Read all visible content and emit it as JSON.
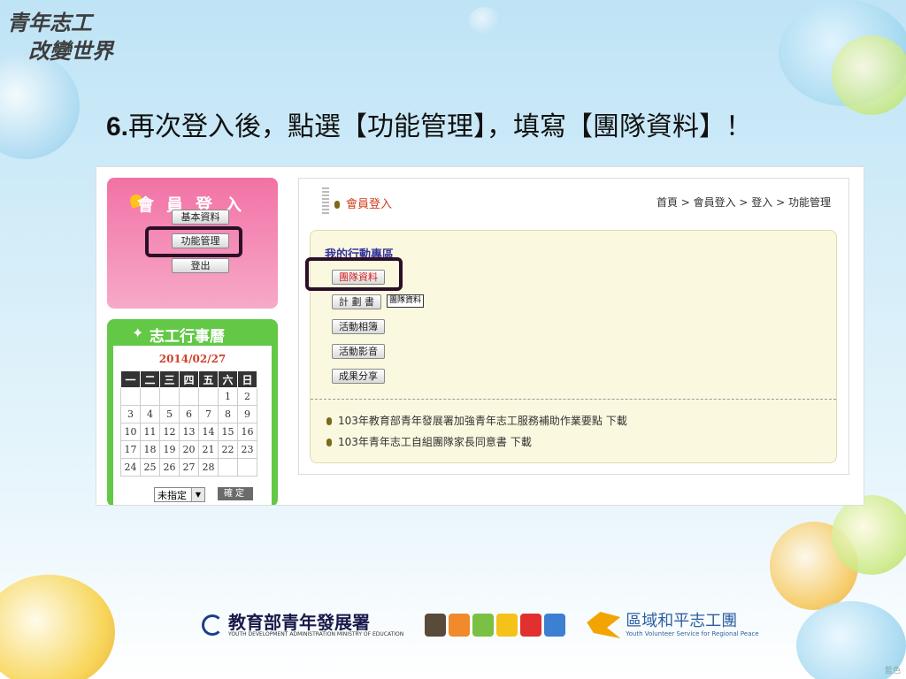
{
  "slogan": {
    "line1": "青年志工",
    "line2": "改變世界"
  },
  "heading": {
    "step": "6.",
    "text": "再次登入後，點選【功能管理】，填寫【團隊資料】！"
  },
  "login": {
    "title": "會員登入",
    "buttons": {
      "basic": "基本資料",
      "manage": "功能管理",
      "logout": "登出"
    }
  },
  "calendar": {
    "title": "志工行事曆",
    "date": "2014/02/27",
    "weekdays": [
      "一",
      "二",
      "三",
      "四",
      "五",
      "六",
      "日"
    ],
    "weeks": [
      [
        "",
        "",
        "",
        "",
        "",
        "1",
        "2"
      ],
      [
        "3",
        "4",
        "5",
        "6",
        "7",
        "8",
        "9"
      ],
      [
        "10",
        "11",
        "12",
        "13",
        "14",
        "15",
        "16"
      ],
      [
        "17",
        "18",
        "19",
        "20",
        "21",
        "22",
        "23"
      ],
      [
        "24",
        "25",
        "26",
        "27",
        "28",
        "",
        ""
      ]
    ],
    "select_value": "未指定",
    "confirm": "確定"
  },
  "main": {
    "title": "會員登入",
    "breadcrumb": "首頁 > 會員登入 > 登入 > 功能管理",
    "section_title": "我的行動專區",
    "buttons": {
      "team": "團隊資料",
      "plan": "計 劃 書",
      "album": "活動相簿",
      "video": "活動影音",
      "share": "成果分享"
    },
    "tooltip": "團隊資料",
    "downloads": [
      {
        "text": "103年教育部青年發展署加強青年志工服務補助作業要點",
        "link": "下載"
      },
      {
        "text": "103年青年志工自組團隊家長同意書",
        "link": "下載"
      }
    ]
  },
  "footer": {
    "logo1": "教育部青年發展署",
    "logo1_sub": "YOUTH DEVELOPMENT ADMINISTRATION MINISTRY OF EDUCATION",
    "logo3": "區域和平志工團",
    "logo3_sub": "Youth Volunteer Service for Regional Peace",
    "corner": "藍色"
  },
  "colors": {
    "login_pink": "#f272a6",
    "calendar_green": "#63c846",
    "panel_cream": "#fbf8e0",
    "highlight": "#2b0f26"
  }
}
